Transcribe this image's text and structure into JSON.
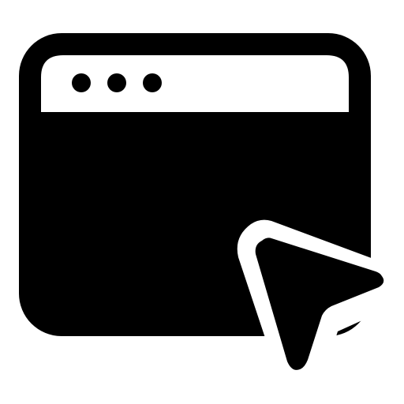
{
  "icon": {
    "name": "browser-window-with-cursor-icon",
    "window_color": "#000000",
    "background_color": "#ffffff",
    "title_bar_dot_count": 3
  }
}
